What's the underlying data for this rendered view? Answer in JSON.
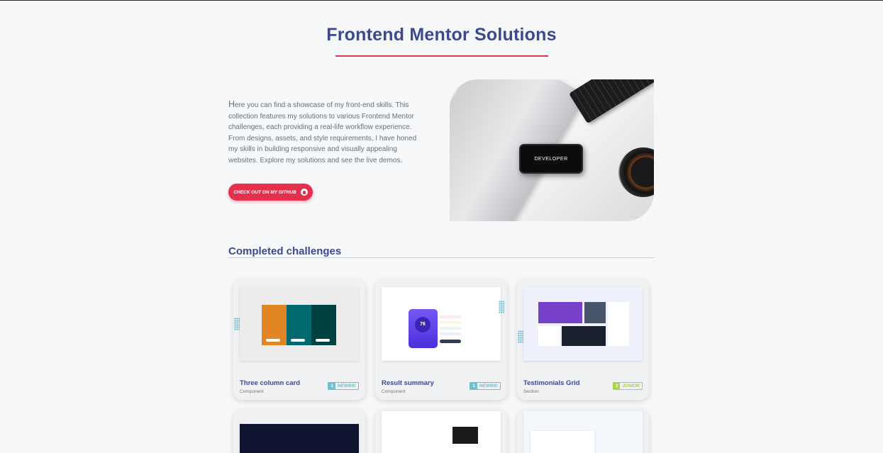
{
  "page_title": "Frontend Mentor Solutions",
  "intro": "Here you can find a showcase of my front-end skills. This collection features my solutions to various Frontend Mentor challenges, each providing a real-life workflow experience. From designs, assets, and style requirements, I have honed my skills in building responsive and visually appealing websites. Explore my solutions and see the live demos.",
  "github_button": {
    "label": "CHECK OUT ON MY GITHUB",
    "icon": "github-icon"
  },
  "hero_image": {
    "phone_text": "DEVELOPER"
  },
  "section_title": "Completed challenges",
  "cards": [
    {
      "name": "Three column card",
      "type": "Component",
      "level_num": "1",
      "level": "NEWBIE",
      "level_color": "#6fc0cf"
    },
    {
      "name": "Result summary",
      "type": "Component",
      "level_num": "1",
      "level": "NEWBIE",
      "level_color": "#6fc0cf",
      "thumb_score": "76"
    },
    {
      "name": "Testimonials Grid",
      "type": "Section",
      "level_num": "2",
      "level": "JUNIOR",
      "level_color": "#a8d34a"
    }
  ],
  "colors": {
    "accent": "#e4304d",
    "heading": "#3b4a8e"
  }
}
